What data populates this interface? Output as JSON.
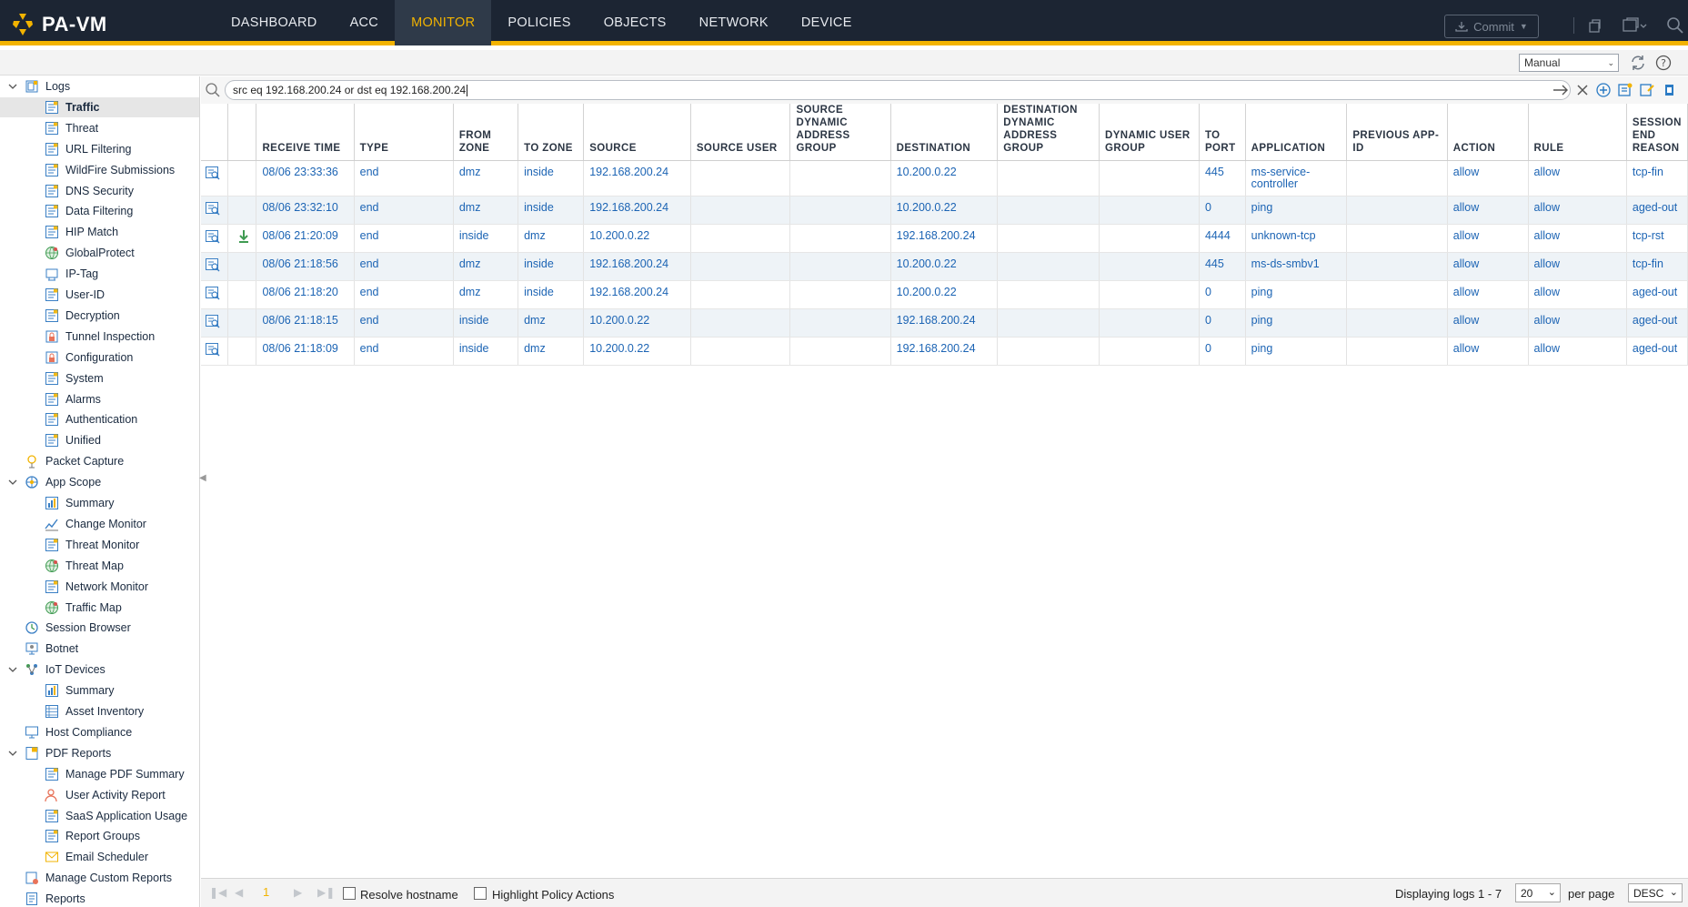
{
  "app": {
    "title": "PA-VM"
  },
  "nav": [
    {
      "label": "DASHBOARD",
      "active": false
    },
    {
      "label": "ACC",
      "active": false
    },
    {
      "label": "MONITOR",
      "active": true
    },
    {
      "label": "POLICIES",
      "active": false
    },
    {
      "label": "OBJECTS",
      "active": false
    },
    {
      "label": "NETWORK",
      "active": false
    },
    {
      "label": "DEVICE",
      "active": false
    }
  ],
  "toolbar": {
    "commit_label": "Commit",
    "refresh_mode": "Manual"
  },
  "sidebar": {
    "items": [
      {
        "label": "Logs",
        "level": 0,
        "expanded": true,
        "icon": "logs-icon"
      },
      {
        "label": "Traffic",
        "level": 1,
        "selected": true,
        "icon": "log-icon"
      },
      {
        "label": "Threat",
        "level": 1,
        "icon": "log-icon"
      },
      {
        "label": "URL Filtering",
        "level": 1,
        "icon": "log-icon"
      },
      {
        "label": "WildFire Submissions",
        "level": 1,
        "icon": "log-icon"
      },
      {
        "label": "DNS Security",
        "level": 1,
        "icon": "log-icon"
      },
      {
        "label": "Data Filtering",
        "level": 1,
        "icon": "log-icon"
      },
      {
        "label": "HIP Match",
        "level": 1,
        "icon": "log-icon"
      },
      {
        "label": "GlobalProtect",
        "level": 1,
        "icon": "globe-icon"
      },
      {
        "label": "IP-Tag",
        "level": 1,
        "icon": "tag-icon"
      },
      {
        "label": "User-ID",
        "level": 1,
        "icon": "log-icon"
      },
      {
        "label": "Decryption",
        "level": 1,
        "icon": "log-icon"
      },
      {
        "label": "Tunnel Inspection",
        "level": 1,
        "icon": "lock-icon"
      },
      {
        "label": "Configuration",
        "level": 1,
        "icon": "lock-icon"
      },
      {
        "label": "System",
        "level": 1,
        "icon": "log-icon"
      },
      {
        "label": "Alarms",
        "level": 1,
        "icon": "log-icon"
      },
      {
        "label": "Authentication",
        "level": 1,
        "icon": "log-icon"
      },
      {
        "label": "Unified",
        "level": 1,
        "icon": "log-icon"
      },
      {
        "label": "Packet Capture",
        "level": 0,
        "icon": "capture-icon"
      },
      {
        "label": "App Scope",
        "level": 0,
        "expanded": true,
        "icon": "scope-icon"
      },
      {
        "label": "Summary",
        "level": 1,
        "icon": "chart-icon"
      },
      {
        "label": "Change Monitor",
        "level": 1,
        "icon": "line-chart-icon"
      },
      {
        "label": "Threat Monitor",
        "level": 1,
        "icon": "log-icon"
      },
      {
        "label": "Threat Map",
        "level": 1,
        "icon": "globe-icon"
      },
      {
        "label": "Network Monitor",
        "level": 1,
        "icon": "log-icon"
      },
      {
        "label": "Traffic Map",
        "level": 1,
        "icon": "globe-icon"
      },
      {
        "label": "Session Browser",
        "level": 0,
        "icon": "session-icon"
      },
      {
        "label": "Botnet",
        "level": 0,
        "icon": "botnet-icon"
      },
      {
        "label": "IoT Devices",
        "level": 0,
        "expanded": true,
        "icon": "iot-icon"
      },
      {
        "label": "Summary",
        "level": 1,
        "icon": "chart-icon"
      },
      {
        "label": "Asset Inventory",
        "level": 1,
        "icon": "table-icon"
      },
      {
        "label": "Host Compliance",
        "level": 0,
        "icon": "monitor-icon"
      },
      {
        "label": "PDF Reports",
        "level": 0,
        "expanded": true,
        "icon": "pdf-icon"
      },
      {
        "label": "Manage PDF Summary",
        "level": 1,
        "icon": "log-icon"
      },
      {
        "label": "User Activity Report",
        "level": 1,
        "icon": "user-icon"
      },
      {
        "label": "SaaS Application Usage",
        "level": 1,
        "icon": "log-icon"
      },
      {
        "label": "Report Groups",
        "level": 1,
        "icon": "log-icon"
      },
      {
        "label": "Email Scheduler",
        "level": 1,
        "icon": "mail-icon"
      },
      {
        "label": "Manage Custom Reports",
        "level": 0,
        "icon": "custom-report-icon"
      },
      {
        "label": "Reports",
        "level": 0,
        "icon": "report-icon"
      }
    ]
  },
  "filter": {
    "query": "src eq 192.168.200.24 or dst eq 192.168.200.24"
  },
  "table": {
    "columns": [
      "",
      "",
      "RECEIVE TIME",
      "TYPE",
      "FROM ZONE",
      "TO ZONE",
      "SOURCE",
      "SOURCE USER",
      "SOURCE DYNAMIC ADDRESS GROUP",
      "DESTINATION",
      "DESTINATION DYNAMIC ADDRESS GROUP",
      "DYNAMIC USER GROUP",
      "TO PORT",
      "APPLICATION",
      "PREVIOUS APP-ID",
      "ACTION",
      "RULE",
      "SESSION END REASON"
    ],
    "rows": [
      {
        "download": false,
        "cells": [
          "08/06 23:33:36",
          "end",
          "dmz",
          "inside",
          "192.168.200.24",
          "",
          "",
          "10.200.0.22",
          "",
          "",
          "445",
          "ms-service-controller",
          "",
          "allow",
          "allow",
          "tcp-fin"
        ]
      },
      {
        "download": false,
        "cells": [
          "08/06 23:32:10",
          "end",
          "dmz",
          "inside",
          "192.168.200.24",
          "",
          "",
          "10.200.0.22",
          "",
          "",
          "0",
          "ping",
          "",
          "allow",
          "allow",
          "aged-out"
        ]
      },
      {
        "download": true,
        "cells": [
          "08/06 21:20:09",
          "end",
          "inside",
          "dmz",
          "10.200.0.22",
          "",
          "",
          "192.168.200.24",
          "",
          "",
          "4444",
          "unknown-tcp",
          "",
          "allow",
          "allow",
          "tcp-rst"
        ]
      },
      {
        "download": false,
        "cells": [
          "08/06 21:18:56",
          "end",
          "dmz",
          "inside",
          "192.168.200.24",
          "",
          "",
          "10.200.0.22",
          "",
          "",
          "445",
          "ms-ds-smbv1",
          "",
          "allow",
          "allow",
          "tcp-fin"
        ]
      },
      {
        "download": false,
        "cells": [
          "08/06 21:18:20",
          "end",
          "dmz",
          "inside",
          "192.168.200.24",
          "",
          "",
          "10.200.0.22",
          "",
          "",
          "0",
          "ping",
          "",
          "allow",
          "allow",
          "aged-out"
        ]
      },
      {
        "download": false,
        "cells": [
          "08/06 21:18:15",
          "end",
          "inside",
          "dmz",
          "10.200.0.22",
          "",
          "",
          "192.168.200.24",
          "",
          "",
          "0",
          "ping",
          "",
          "allow",
          "allow",
          "aged-out"
        ]
      },
      {
        "download": false,
        "cells": [
          "08/06 21:18:09",
          "end",
          "inside",
          "dmz",
          "10.200.0.22",
          "",
          "",
          "192.168.200.24",
          "",
          "",
          "0",
          "ping",
          "",
          "allow",
          "allow",
          "aged-out"
        ]
      }
    ]
  },
  "footer": {
    "page": "1",
    "resolve_hostname": "Resolve hostname",
    "highlight_policy": "Highlight Policy Actions",
    "display_text": "Displaying logs 1 - 7",
    "per_page_value": "20",
    "per_page_label": "per page",
    "order": "DESC"
  },
  "colors": {
    "nav_bg": "#1c2533",
    "accent": "#f2b300",
    "link": "#1c64b4",
    "row_alt": "#eef3f7"
  }
}
